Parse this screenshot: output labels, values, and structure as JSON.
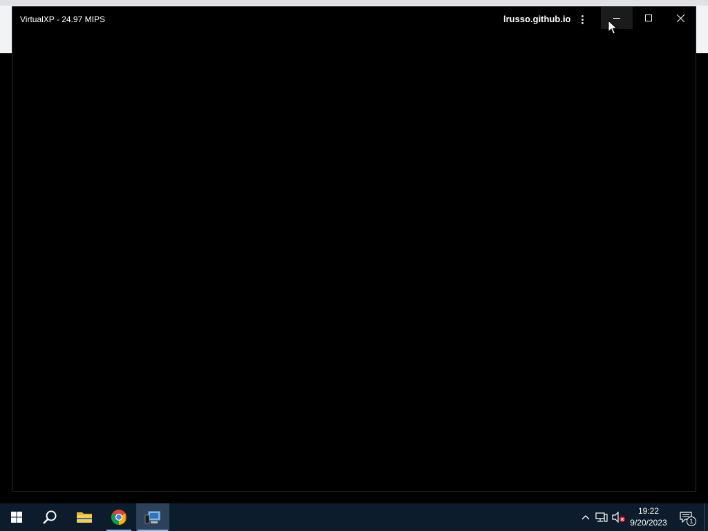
{
  "window": {
    "title": "VirtualXP - 24.97 MIPS",
    "origin": "lrusso.github.io",
    "buttons": {
      "menu": "more-options",
      "minimize": "minimize",
      "maximize": "maximize",
      "close": "close"
    }
  },
  "taskbar": {
    "apps": [
      {
        "name": "start",
        "icon": "windows-logo-icon"
      },
      {
        "name": "search",
        "icon": "search-icon"
      },
      {
        "name": "file-explorer",
        "icon": "folder-icon"
      },
      {
        "name": "chrome",
        "icon": "chrome-icon"
      },
      {
        "name": "virtualxp",
        "icon": "virtualxp-icon",
        "active": true
      }
    ],
    "tray": {
      "icons": [
        "chevron-up-icon",
        "network-icon",
        "volume-muted-icon"
      ]
    },
    "clock": {
      "time": "19:22",
      "date": "9/20/2023"
    },
    "notifications": {
      "count": "1"
    }
  },
  "colors": {
    "taskbar": "#0c1c2c",
    "active_app": "#2d4258",
    "accent": "#76b9ed",
    "window_bg": "#000000"
  }
}
